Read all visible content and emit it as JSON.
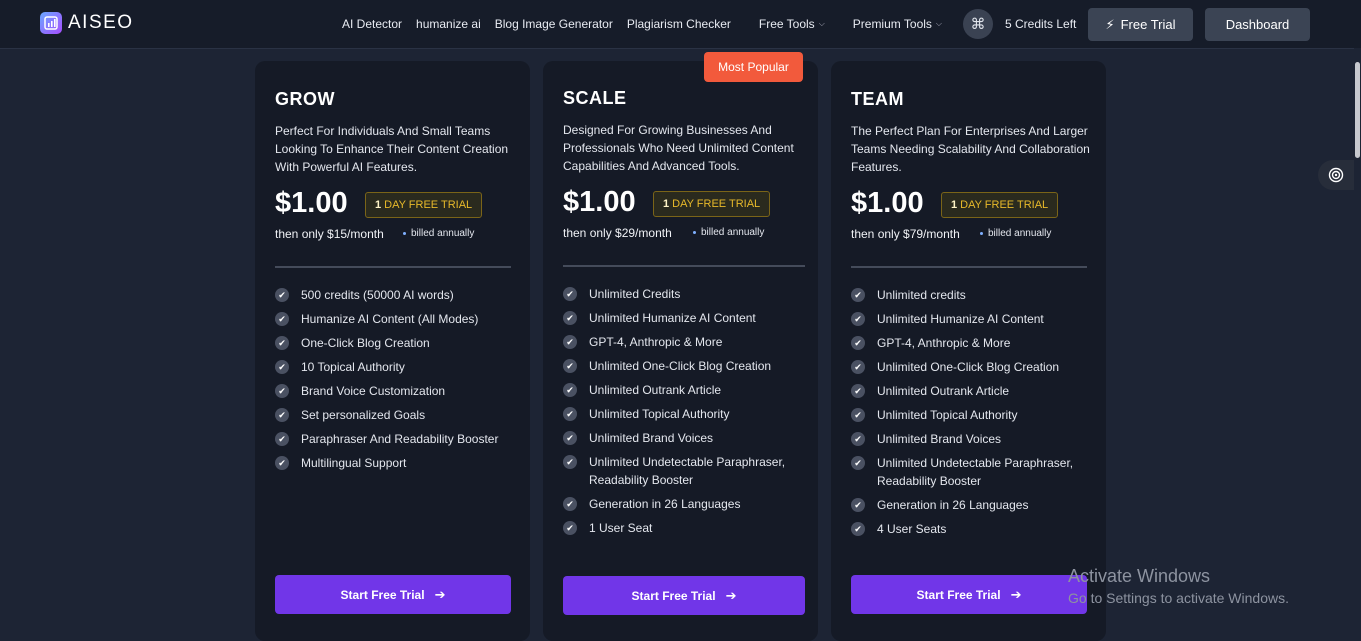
{
  "nav": {
    "logo_text": "AISEO",
    "links": [
      "AI Detector",
      "humanize ai",
      "Blog Image Generator",
      "Plagiarism Checker"
    ],
    "dropdowns": [
      "Free Tools",
      "Premium Tools"
    ],
    "command_glyph": "⌘",
    "credits": "5 Credits Left",
    "free_trial_label": "Free Trial",
    "dashboard_label": "Dashboard"
  },
  "badge_most_popular": "Most Popular",
  "plans": [
    {
      "name": "GROW",
      "description": "Perfect For Individuals And Small Teams Looking To Enhance Their Content Creation With Powerful AI Features.",
      "price": "$1.00",
      "trial_bold": "1",
      "trial_text": "DAY FREE TRIAL",
      "then": "then only $15/month",
      "billed": "billed annually",
      "features": [
        "500 credits (50000 AI words)",
        "Humanize AI Content (All Modes)",
        "One-Click Blog Creation",
        "10 Topical Authority",
        "Brand Voice Customization",
        "Set personalized Goals",
        "Paraphraser And Readability Booster",
        "Multilingual Support"
      ],
      "cta": "Start Free Trial"
    },
    {
      "name": "SCALE",
      "description": "Designed For Growing Businesses And Professionals Who Need Unlimited Content Capabilities And Advanced Tools.",
      "price": "$1.00",
      "trial_bold": "1",
      "trial_text": "DAY FREE TRIAL",
      "then": "then only $29/month",
      "billed": "billed annually",
      "features": [
        "Unlimited Credits",
        "Unlimited Humanize AI Content",
        "GPT-4, Anthropic & More",
        "Unlimited One-Click Blog Creation",
        "Unlimited Outrank Article",
        "Unlimited Topical Authority",
        "Unlimited Brand Voices",
        "Unlimited Undetectable Paraphraser, Readability Booster",
        "Generation in 26 Languages",
        "1 User Seat"
      ],
      "cta": "Start Free Trial"
    },
    {
      "name": "TEAM",
      "description": "The Perfect Plan For Enterprises And Larger Teams Needing Scalability And Collaboration Features.",
      "price": "$1.00",
      "trial_bold": "1",
      "trial_text": "DAY FREE TRIAL",
      "then": "then only $79/month",
      "billed": "billed annually",
      "features": [
        "Unlimited credits",
        "Unlimited Humanize AI Content",
        "GPT-4, Anthropic & More",
        "Unlimited One-Click Blog Creation",
        "Unlimited Outrank Article",
        "Unlimited Topical Authority",
        "Unlimited Brand Voices",
        "Unlimited Undetectable Paraphraser, Readability Booster",
        "Generation in 26 Languages",
        "4 User Seats"
      ],
      "cta": "Start Free Trial"
    }
  ],
  "watermark": {
    "line1": "Activate Windows",
    "line2": "Go to Settings to activate Windows."
  },
  "colors": {
    "background": "#1d2434",
    "card": "#151a26",
    "accent_purple": "#7136e8",
    "popular_orange": "#f25a3c",
    "trial_gold": "#e7b92a"
  }
}
